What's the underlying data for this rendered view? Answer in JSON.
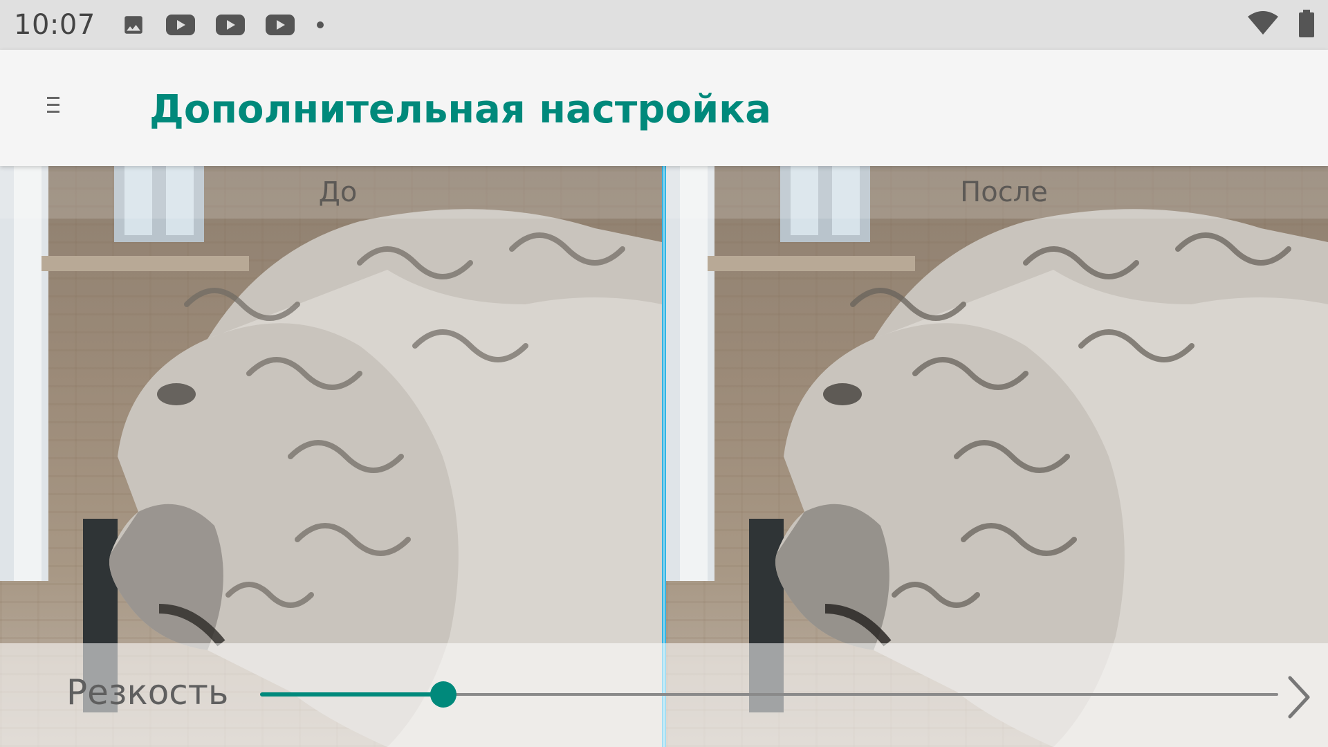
{
  "status_bar": {
    "time": "10:07",
    "icons": [
      "image-icon",
      "youtube-icon",
      "youtube-icon",
      "youtube-icon",
      "dot-icon"
    ],
    "right_icons": [
      "wifi-icon",
      "battery-icon"
    ]
  },
  "app_bar": {
    "title": "Дополнительная настройка",
    "menu_icon": "menu-icon",
    "title_color": "#00897b"
  },
  "comparison": {
    "before_label": "До",
    "after_label": "После",
    "divider_color": "#33b5e5"
  },
  "control": {
    "label": "Резкость",
    "slider_value": 0.18,
    "accent_color": "#00897b",
    "next_icon": "chevron-right-icon"
  }
}
